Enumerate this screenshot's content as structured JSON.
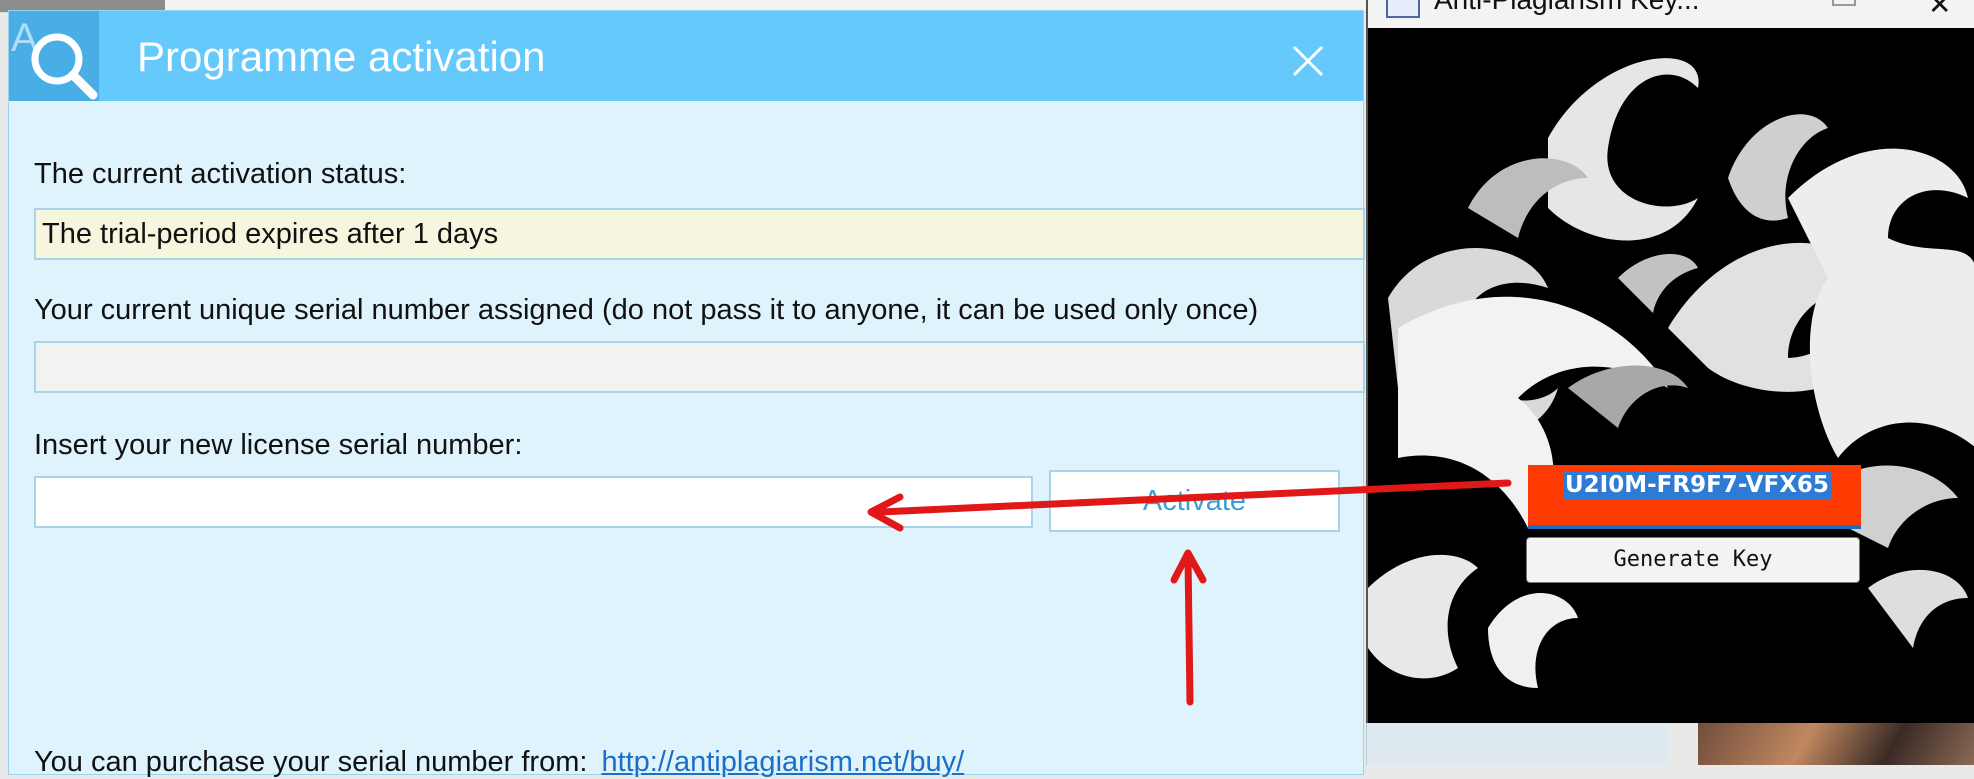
{
  "dialog": {
    "title": "Programme activation",
    "status_label": "The current activation status:",
    "status_value": "The trial-period expires after 1 days",
    "serial_label": "Your current unique serial number assigned (do not pass it to anyone, it can be used only once)",
    "serial_value": "",
    "new_serial_label": "Insert your new license serial number:",
    "new_serial_value": "",
    "activate_label": "Activate",
    "purchase_text": "You can purchase your serial number from:",
    "purchase_link": "http://antiplagiarism.net/buy/"
  },
  "keygen": {
    "title": "Anti-Plagiarism Key...",
    "serial_output": "U2I0M-FR9F7-VFX65",
    "generate_label": "Generate Key"
  },
  "colors": {
    "titlebar": "#66c9fb",
    "dialog_bg": "#dff3fd",
    "status_bg": "#f6f5dd",
    "serial_box": "#ff3a00",
    "arrow": "#e01818",
    "link": "#1a6fc9"
  },
  "icons": {
    "app": "magnifier-logo-icon",
    "close": "close-icon",
    "keygen_app": "window-app-icon"
  }
}
